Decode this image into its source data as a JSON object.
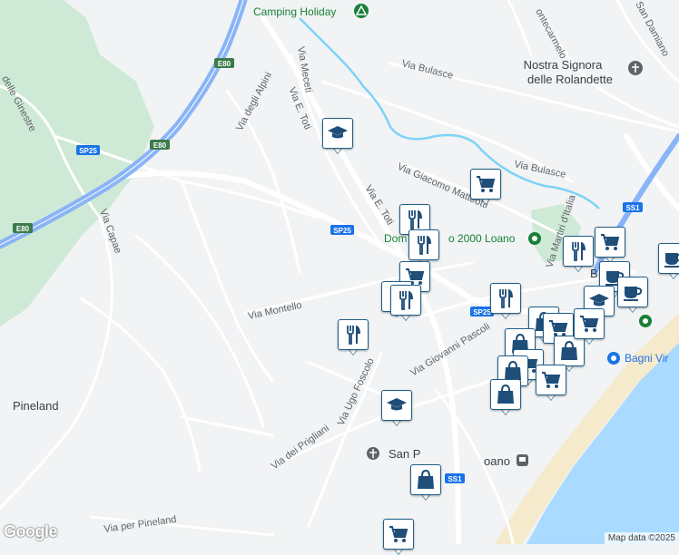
{
  "map": {
    "places": {
      "camping_holiday": "Camping Holiday",
      "nostra_signora_1": "Nostra Signora",
      "nostra_signora_2": "delle Rolandette",
      "pineland": "Pineland",
      "dominion_partial": "Dom",
      "dominion_rest": "o 2000 Loano",
      "bagni_partial": "Bagni Vir",
      "loano_partial": "oano",
      "san_partial": "San P",
      "corner_label": "B"
    },
    "roads": {
      "via_meceti": "Via Meceti",
      "via_e_toti_1": "Via E. Toti",
      "via_e_toti_2": "Via E. Toti",
      "via_degli_alpini": "Via degli Alpini",
      "via_bulasce_1": "Via Bulasce",
      "via_bulasce_2": "Via Bulasce",
      "via_giacomo_matteotti": "Via Giacomo Matteotti",
      "via_capae": "Via Capae",
      "via_montello": "Via Montello",
      "via_giovanni_pascoli": "Via Giovanni Pascoli",
      "via_ugo_foscolo": "Via Ugo Foscolo",
      "via_dei_prigliani": "Via dei Prigliani",
      "via_per_pineland": "Via per Pineland",
      "via_delle_ginestre": "delle Ginestre",
      "via_martiri": "Via Martiri d'Italia",
      "via_montecarmelo": "ontecarmelo",
      "via_damiano": "San Damiano",
      "ss1": "SS1"
    },
    "shields": {
      "e80_a": "E80",
      "e80_b": "E80",
      "e80_c": "E80",
      "sp25_a": "SP25",
      "sp25_b": "SP25",
      "sp25_c": "SP25",
      "ss1_a": "SS1",
      "ss1_b": "SS1"
    },
    "markers": [
      {
        "type": "education",
        "icon": "graduation-cap-icon"
      },
      {
        "type": "supermarket",
        "icon": "shopping-cart-icon"
      },
      {
        "type": "restaurant",
        "icon": "fork-knife-icon"
      },
      {
        "type": "restaurant",
        "icon": "fork-knife-icon"
      },
      {
        "type": "supermarket",
        "icon": "shopping-cart-icon"
      },
      {
        "type": "restaurant",
        "icon": "fork-knife-icon"
      },
      {
        "type": "restaurant",
        "icon": "fork-knife-icon"
      },
      {
        "type": "restaurant",
        "icon": "fork-knife-icon"
      },
      {
        "type": "restaurant",
        "icon": "fork-knife-icon"
      },
      {
        "type": "supermarket",
        "icon": "shopping-cart-icon"
      },
      {
        "type": "cafe",
        "icon": "coffee-cup-icon"
      },
      {
        "type": "education",
        "icon": "graduation-cap-icon"
      },
      {
        "type": "cafe",
        "icon": "coffee-cup-icon"
      },
      {
        "type": "cafe",
        "icon": "coffee-cup-icon"
      },
      {
        "type": "shopping",
        "icon": "shopping-bag-icon"
      },
      {
        "type": "supermarket",
        "icon": "shopping-cart-icon"
      },
      {
        "type": "shopping",
        "icon": "shopping-bag-icon"
      },
      {
        "type": "supermarket",
        "icon": "shopping-cart-icon"
      },
      {
        "type": "shopping",
        "icon": "shopping-bag-icon"
      },
      {
        "type": "supermarket",
        "icon": "shopping-cart-icon"
      },
      {
        "type": "shopping",
        "icon": "shopping-bag-icon"
      },
      {
        "type": "education",
        "icon": "graduation-cap-icon"
      },
      {
        "type": "shopping",
        "icon": "shopping-bag-icon"
      },
      {
        "type": "restaurant",
        "icon": "fork-knife-icon"
      },
      {
        "type": "supermarket",
        "icon": "shopping-cart-icon"
      },
      {
        "type": "shopping",
        "icon": "shopping-bag-icon"
      },
      {
        "type": "supermarket",
        "icon": "shopping-cart-icon"
      }
    ],
    "colors": {
      "background": "#f1f3f4",
      "park": "#ceead6",
      "sea": "#aadaff",
      "sand": "#f5eacc",
      "highway": "#8ab4f8",
      "river": "#7ed3f7",
      "marker_border": "#1f5f8b",
      "marker_icon": "#1f4e79",
      "poi_green": "#188038",
      "poi_blue": "#1a73e8"
    }
  },
  "branding": {
    "logo": "Google",
    "attribution": "Map data ©2025"
  }
}
